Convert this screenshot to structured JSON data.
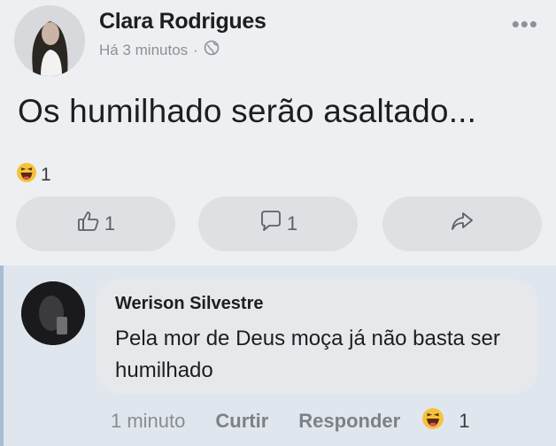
{
  "post": {
    "author": "Clara Rodrigues",
    "time": "Há 3 minutos",
    "separator": "·",
    "privacy_icon": "globe-icon",
    "text": "Os humilhado serão asaltado...",
    "reaction_icon": "haha-emoji-icon",
    "reaction_count": "1",
    "like_count": "1",
    "comment_count": "1"
  },
  "comment": {
    "author": "Werison Silvestre",
    "text": "Pela mor de Deus moça já não basta ser humilhado",
    "time": "1 minuto",
    "like_label": "Curtir",
    "reply_label": "Responder",
    "reaction_icon": "haha-emoji-icon",
    "reaction_count": "1"
  },
  "colors": {
    "background": "#eeeff2",
    "comment_background": "#e0e6ee",
    "button_background": "#dfe0e4",
    "reaction_yellow": "#f5c33b"
  }
}
